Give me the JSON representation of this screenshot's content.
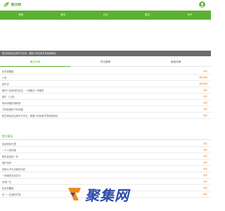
{
  "header": {
    "site_name": "散文网"
  },
  "nav": [
    {
      "label": "首页"
    },
    {
      "label": "美文"
    },
    {
      "label": "日志"
    },
    {
      "label": "散文"
    },
    {
      "label": "句子"
    }
  ],
  "notice": {
    "text": "散文网旨在弘扬中华文化，做国人的优美文章阅读网站"
  },
  "tabs": [
    {
      "label": "散文头条",
      "active": true
    },
    {
      "label": "好文推荐",
      "active": false
    },
    {
      "label": "阅读月榜",
      "active": false
    }
  ],
  "headline_list": [
    {
      "title": "秋天的醒悟",
      "tag": "美文"
    },
    {
      "title": "少年",
      "tag": "散文随笔"
    },
    {
      "title": "回不去",
      "tag": "散文随笔"
    },
    {
      "title": "腐朽人生风雨中走过，一年春去一年春来",
      "tag": "美文"
    },
    {
      "title": "端午（三调）",
      "tag": "美文"
    },
    {
      "title": "夜深未眠的难耐到",
      "tag": "感悟"
    },
    {
      "title": "夕阳西落的千年祝福",
      "tag": "美文"
    },
    {
      "title": "散文网旨在弘扬中华文化，做国人的优美文章阅读网站",
      "tag": "美文"
    }
  ],
  "section": {
    "title": "散文精选"
  },
  "featured_list": [
    {
      "title": "遥远的秋天里",
      "tag": "美文"
    },
    {
      "title": "一个人的时候",
      "tag": "美文"
    },
    {
      "title": "明天依旧如一年",
      "tag": "美文"
    },
    {
      "title": "端午情怀",
      "tag": "美文"
    },
    {
      "title": "我是从不忘记我的当初",
      "tag": "美文"
    },
    {
      "title": "一把扇的流动岁月",
      "tag": "美文"
    },
    {
      "title": "初遇一生",
      "tag": "美文"
    },
    {
      "title": "秋天的醒悟",
      "tag": "美文"
    },
    {
      "title": "花一一生我的守望",
      "tag": "美文"
    }
  ],
  "watermark": {
    "text": "聚集网"
  },
  "colors": {
    "brand_green": "#5bb131",
    "tag_orange": "#e9802a",
    "watermark_blue": "#2b4aa8"
  },
  "icons": {
    "logo": "leaf-logo-icon",
    "user": "user-icon"
  }
}
